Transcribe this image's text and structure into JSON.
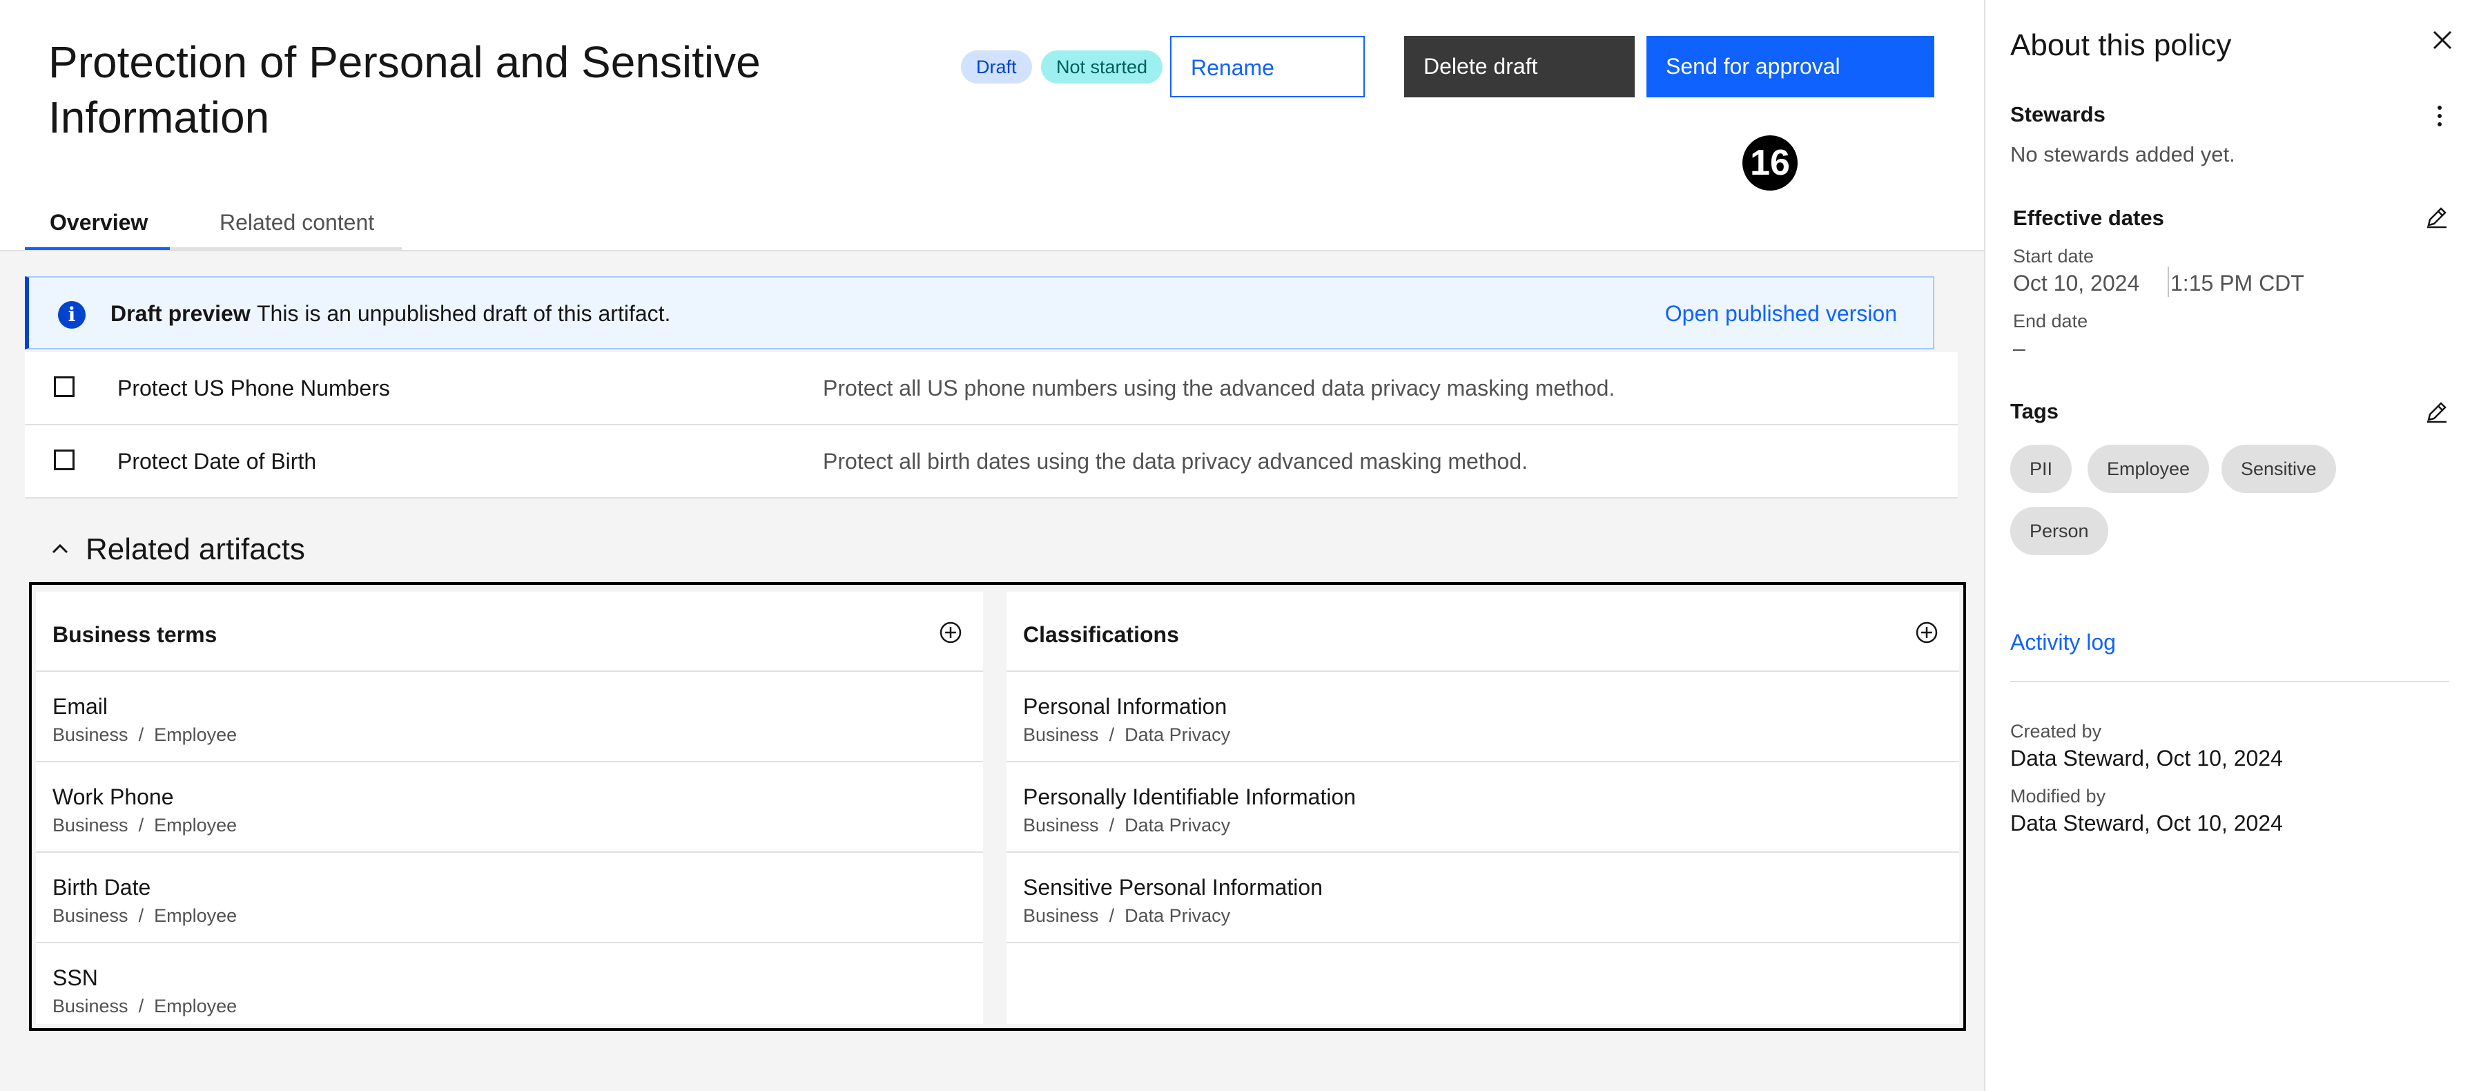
{
  "header": {
    "title": "Protection of Personal and Sensitive Information",
    "status_draft": "Draft",
    "status_progress": "Not started",
    "rename_label": "Rename",
    "delete_label": "Delete draft",
    "send_label": "Send for approval",
    "step_marker": "16"
  },
  "tabs": [
    {
      "label": "Overview",
      "selected": true
    },
    {
      "label": "Related content",
      "selected": false
    }
  ],
  "notice": {
    "title": "Draft preview",
    "text": "This is an unpublished draft of this artifact.",
    "link": "Open published version",
    "icon": "info-icon"
  },
  "rules": [
    {
      "name": "Protect US Phone Numbers",
      "description": "Protect all US phone numbers using the advanced data privacy masking method.",
      "checked": false
    },
    {
      "name": "Protect Date of Birth",
      "description": "Protect all birth dates using the data privacy advanced masking method.",
      "checked": false
    }
  ],
  "related": {
    "title": "Related artifacts",
    "business_terms": {
      "heading": "Business terms",
      "items": [
        {
          "name": "Email",
          "path_root": "Business",
          "path_leaf": "Employee"
        },
        {
          "name": "Work Phone",
          "path_root": "Business",
          "path_leaf": "Employee"
        },
        {
          "name": "Birth Date",
          "path_root": "Business",
          "path_leaf": "Employee"
        },
        {
          "name": "SSN",
          "path_root": "Business",
          "path_leaf": "Employee"
        }
      ]
    },
    "classifications": {
      "heading": "Classifications",
      "items": [
        {
          "name": "Personal Information",
          "path_root": "Business",
          "path_leaf": "Data Privacy"
        },
        {
          "name": "Personally Identifiable Information",
          "path_root": "Business",
          "path_leaf": "Data Privacy"
        },
        {
          "name": "Sensitive Personal Information",
          "path_root": "Business",
          "path_leaf": "Data Privacy"
        }
      ]
    },
    "path_separator": "/"
  },
  "panel": {
    "title": "About this policy",
    "stewards": {
      "heading": "Stewards",
      "empty": "No stewards added yet."
    },
    "dates": {
      "heading": "Effective dates",
      "start_label": "Start date",
      "start_date": "Oct 10, 2024",
      "start_time": "1:15 PM CDT",
      "end_label": "End date",
      "end_value": "–"
    },
    "tags": {
      "heading": "Tags",
      "items": [
        "PII",
        "Employee",
        "Sensitive",
        "Person"
      ]
    },
    "activity_link": "Activity log",
    "created_label": "Created by",
    "created_value": "Data Steward, Oct 10, 2024",
    "modified_label": "Modified by",
    "modified_value": "Data Steward, Oct 10, 2024"
  },
  "colors": {
    "primary": "#0f62fe",
    "danger_dark": "#393939",
    "draft_tag_bg": "#d0e2ff",
    "not_started_tag_bg": "#9ef0f0",
    "notice_bg": "#edf5ff"
  }
}
